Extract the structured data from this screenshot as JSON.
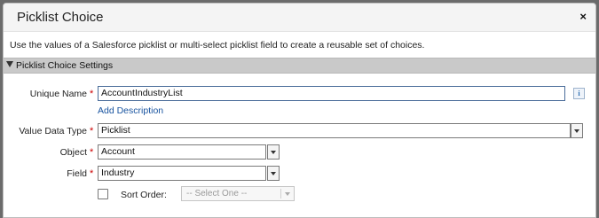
{
  "dialog": {
    "title": "Picklist Choice",
    "close_glyph": "×",
    "description": "Use the values of a Salesforce picklist or multi-select picklist field to create a reusable set of choices."
  },
  "section": {
    "title": "Picklist Choice Settings",
    "toggle_icon": "triangle-down-icon"
  },
  "form": {
    "unique_name": {
      "label": "Unique Name",
      "value": "AccountIndustryList",
      "required_mark": "*",
      "info_glyph": "i"
    },
    "add_description": "Add Description",
    "value_data_type": {
      "label": "Value Data Type",
      "value": "Picklist",
      "required_mark": "*"
    },
    "object": {
      "label": "Object",
      "value": "Account",
      "required_mark": "*"
    },
    "field": {
      "label": "Field",
      "value": "Industry",
      "required_mark": "*"
    },
    "sort_order": {
      "label": "Sort Order:",
      "checked": false,
      "placeholder": "-- Select One --"
    }
  },
  "colors": {
    "required": "#cc0000",
    "link": "#1a55a0",
    "section_bar": "#c9c9c9"
  }
}
